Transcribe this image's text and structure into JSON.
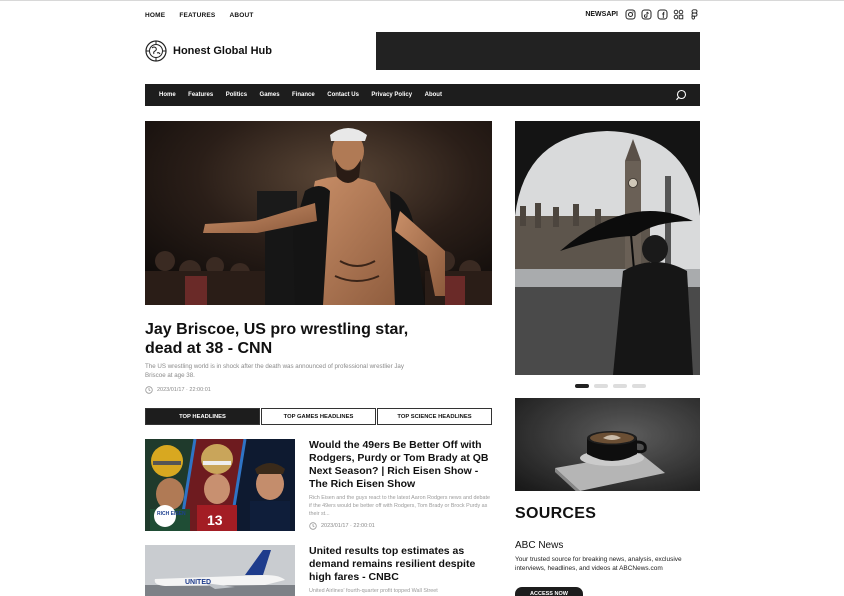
{
  "topnav": {
    "items": [
      "HOME",
      "FEATURES",
      "ABOUT"
    ]
  },
  "topright": {
    "brand": "NEWSAPI",
    "icons": [
      "instagram-icon",
      "tiktok-icon",
      "facebook-icon",
      "grid-icon",
      "figma-icon"
    ]
  },
  "site": {
    "name": "Honest Global Hub"
  },
  "mainnav": {
    "items": [
      "Home",
      "Features",
      "Politics",
      "Games",
      "Finance",
      "Contact Us",
      "Privacy Policy",
      "About"
    ]
  },
  "hero": {
    "title": "Jay Briscoe, US pro wrestling star, dead at 38 - CNN",
    "description": "The US wrestling world is in shock after the death was announced of professional wrestlier Jay Briscoe at age 38.",
    "datetime": "2023/01/17 · 22:00:01"
  },
  "tabs": [
    "TOP HEADLINES",
    "TOP GAMES HEADLINES",
    "TOP SCIENCE HEADLINES"
  ],
  "articles": [
    {
      "title": "Would the 49ers Be Better Off with Rodgers, Purdy or Tom Brady at QB Next Season? | Rich Eisen Show - The Rich Eisen Show",
      "description": "Rich Eisen and the guys react to the latest Aaron Rodgers news and debate if the 49ers would be better off with Rodgers, Tom Brady or Brock Purdy as their st...",
      "datetime": "2023/01/17 · 22:00:01",
      "image_text": "RICH EISEN"
    },
    {
      "title": "United results top estimates as demand remains resilient despite high fares - CNBC",
      "description": "United Airlines' fourth-quarter profit topped Wall Street",
      "image_text": "UNITED"
    }
  ],
  "slider": {
    "dots": 4,
    "active": 0
  },
  "sources": {
    "heading": "SOURCES",
    "name": "ABC News",
    "description": "Your trusted source for breaking news, analysis, exclusive interviews, headlines, and videos at ABCNews.com",
    "button": "ACCESS NOW"
  },
  "colors": {
    "nav_bg": "#1d1d1d",
    "muted_text": "#8a8a8a",
    "ad_bg": "#222222"
  }
}
